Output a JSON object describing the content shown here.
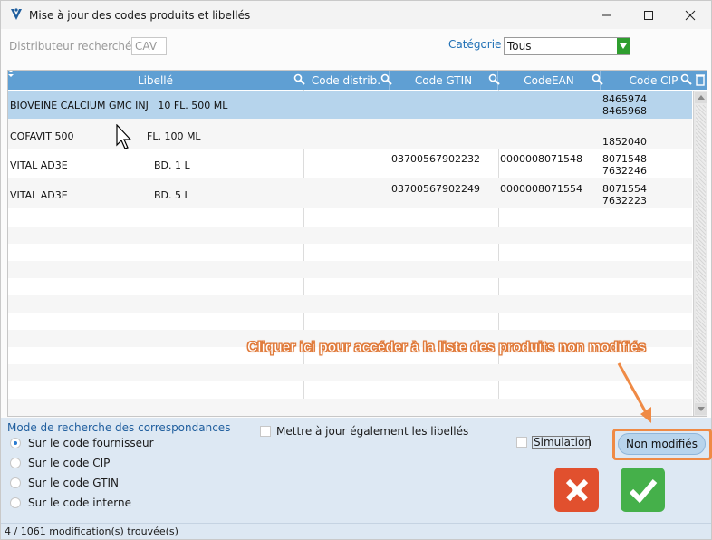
{
  "window": {
    "title": "Mise à jour des codes produits et libellés",
    "icons": {
      "app": "app-logo-icon",
      "minimize": "minimize-icon",
      "maximize": "maximize-icon",
      "close": "close-icon"
    }
  },
  "filters": {
    "distributeur_label": "Distributeur recherché",
    "distributeur_value": "CAV",
    "categorie_label": "Catégorie",
    "categorie_value": "Tous"
  },
  "grid": {
    "columns": [
      "Libellé",
      "Code distrib.",
      "Code GTIN",
      "CodeEAN",
      "Code CIP"
    ],
    "rows": [
      {
        "libelle": "BIOVEINE CALCIUM GMC INJ   10 FL. 500 ML",
        "code_distrib": "",
        "gtin": "",
        "ean": "",
        "cip": [
          "8465974",
          "8465968"
        ],
        "selected": true
      },
      {
        "libelle": "COFAVIT 500",
        "conditionnement": "FL. 100 ML",
        "code_distrib": "",
        "gtin": "",
        "ean": "",
        "cip": [
          "",
          "1852040"
        ]
      },
      {
        "libelle": "VITAL AD3E",
        "conditionnement": "BD. 1 L",
        "code_distrib": "",
        "gtin": "03700567902232",
        "ean": "0000008071548",
        "cip": [
          "8071548",
          "7632246"
        ]
      },
      {
        "libelle": "VITAL AD3E",
        "conditionnement": "BD. 5 L",
        "code_distrib": "",
        "gtin": "03700567902249",
        "ean": "0000008071554",
        "cip": [
          "8071554",
          "7632223"
        ]
      }
    ]
  },
  "mode": {
    "title": "Mode de recherche des correspondances",
    "options": [
      "Sur le code fournisseur",
      "Sur le code CIP",
      "Sur le code GTIN",
      "Sur le code interne"
    ],
    "selected_index": 0
  },
  "options": {
    "update_labels": "Mettre à jour également les libellés",
    "simulation": "Simulation"
  },
  "annotation": "Cliquer ici pour accéder à la liste des produits non modifiés",
  "buttons": {
    "non_modifies": "Non modifiés",
    "cancel_icon": "cancel-x-icon",
    "ok_icon": "checkmark-icon"
  },
  "status": "4 / 1061 modification(s) trouvée(s)",
  "colors": {
    "header": "#5f9fd3",
    "selected_row": "#b6d4ec",
    "cancel": "#e1502e",
    "ok": "#45b04a",
    "annotation": "#ef8a45"
  }
}
